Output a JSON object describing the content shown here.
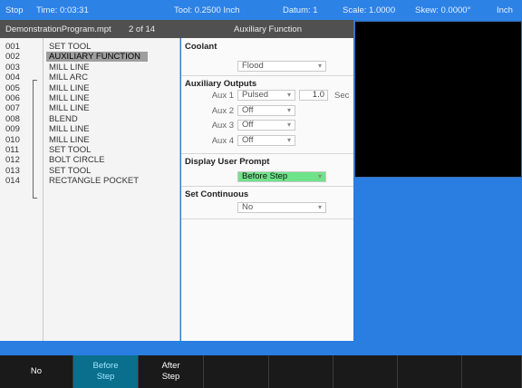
{
  "status": {
    "mode": "Stop",
    "time": "Time: 0:03:31",
    "tool": "Tool: 0.2500 Inch",
    "datum": "Datum: 1",
    "scale": "Scale: 1.0000",
    "skew": "Skew: 0.0000°",
    "units": "Inch"
  },
  "header": {
    "filename": "DemonstrationProgram.mpt",
    "position": "2 of 14",
    "panel_title": "Auxiliary Function"
  },
  "program": [
    {
      "num": "001",
      "label": "SET TOOL"
    },
    {
      "num": "002",
      "label": "AUXILIARY FUNCTION"
    },
    {
      "num": "003",
      "label": "MILL LINE"
    },
    {
      "num": "004",
      "label": "MILL ARC"
    },
    {
      "num": "005",
      "label": "MILL LINE"
    },
    {
      "num": "006",
      "label": "MILL LINE"
    },
    {
      "num": "007",
      "label": "MILL LINE"
    },
    {
      "num": "008",
      "label": "BLEND"
    },
    {
      "num": "009",
      "label": "MILL LINE"
    },
    {
      "num": "010",
      "label": "MILL LINE"
    },
    {
      "num": "011",
      "label": "SET TOOL"
    },
    {
      "num": "012",
      "label": "BOLT CIRCLE"
    },
    {
      "num": "013",
      "label": "SET TOOL"
    },
    {
      "num": "014",
      "label": "RECTANGLE POCKET"
    }
  ],
  "detail": {
    "coolant": {
      "title": "Coolant",
      "value": "Flood"
    },
    "aux_outputs": {
      "title": "Auxiliary Outputs",
      "rows": [
        {
          "label": "Aux 1",
          "value": "Pulsed",
          "duration": "1.0",
          "unit": "Sec"
        },
        {
          "label": "Aux 2",
          "value": "Off"
        },
        {
          "label": "Aux 3",
          "value": "Off"
        },
        {
          "label": "Aux 4",
          "value": "Off"
        }
      ]
    },
    "prompt": {
      "title": "Display User Prompt",
      "value": "Before Step"
    },
    "continuous": {
      "title": "Set Continuous",
      "value": "No"
    }
  },
  "softkeys": [
    {
      "line1": "No",
      "line2": ""
    },
    {
      "line1": "Before",
      "line2": "Step"
    },
    {
      "line1": "After",
      "line2": "Step"
    },
    {
      "line1": "",
      "line2": ""
    },
    {
      "line1": "",
      "line2": ""
    },
    {
      "line1": "",
      "line2": ""
    },
    {
      "line1": "",
      "line2": ""
    },
    {
      "line1": "",
      "line2": ""
    }
  ],
  "colors": {
    "status_bar": "#2d82e6",
    "highlight_green": "#6ee38a",
    "active_softkey": "#0a6f8c"
  }
}
